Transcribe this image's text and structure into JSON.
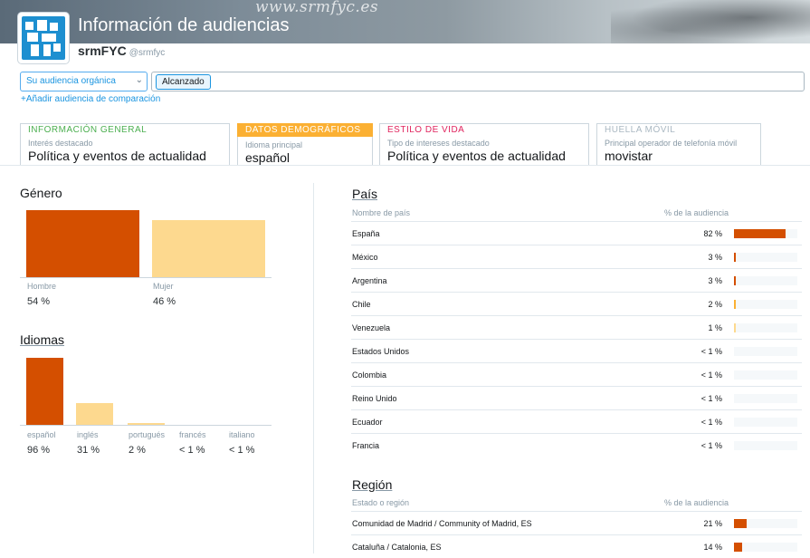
{
  "header": {
    "watermark": "www.srmfyc.es",
    "title": "Información de audiencias",
    "name": "srmFYC",
    "handle": "@srmfyc"
  },
  "controls": {
    "audience_select": "Su audiencia orgánica",
    "chip": "Alcanzado",
    "add_comparison": "+Añadir audiencia de comparación"
  },
  "cards": [
    {
      "category": "INFORMACIÓN GENERAL",
      "subtitle": "Interés destacado",
      "value": "Política y eventos de actualidad",
      "color": "#4caf50"
    },
    {
      "category": "DATOS DEMOGRÁFICOS",
      "subtitle": "Idioma principal",
      "value": "español",
      "color": "#fbb033"
    },
    {
      "category": "ESTILO DE VIDA",
      "subtitle": "Tipo de intereses destacado",
      "value": "Política y eventos de actualidad",
      "color": "#e0245e"
    },
    {
      "category": "HUELLA MÓVIL",
      "subtitle": "Principal operador de telefonía móvil",
      "value": "movistar",
      "color": "#aab8c2"
    }
  ],
  "gender": {
    "title": "Género",
    "items": [
      {
        "label": "Hombre",
        "pct": "54 %",
        "value": 54,
        "color": "#d44f00"
      },
      {
        "label": "Mujer",
        "pct": "46 %",
        "value": 46,
        "color": "#fdd98f"
      }
    ]
  },
  "languages": {
    "title": "Idiomas",
    "items": [
      {
        "label": "español",
        "pct": "96 %",
        "value": 96,
        "color": "#d44f00"
      },
      {
        "label": "inglés",
        "pct": "31 %",
        "value": 31,
        "color": "#fdd98f"
      },
      {
        "label": "portugués",
        "pct": "2 %",
        "value": 2,
        "color": "#fdd98f"
      },
      {
        "label": "francés",
        "pct": "< 1 %",
        "value": 0,
        "color": "#fdd98f"
      },
      {
        "label": "italiano",
        "pct": "< 1 %",
        "value": 0,
        "color": "#fdd98f"
      }
    ]
  },
  "country": {
    "title": "País",
    "col_name": "Nombre de país",
    "col_pct": "% de la audiencia",
    "rows": [
      {
        "name": "España",
        "pct": "82 %",
        "value": 82,
        "color": "#d44f00"
      },
      {
        "name": "México",
        "pct": "3 %",
        "value": 3,
        "color": "#d44f00"
      },
      {
        "name": "Argentina",
        "pct": "3 %",
        "value": 3,
        "color": "#d44f00"
      },
      {
        "name": "Chile",
        "pct": "2 %",
        "value": 2,
        "color": "#fbb033"
      },
      {
        "name": "Venezuela",
        "pct": "1 %",
        "value": 1,
        "color": "#fdd98f"
      },
      {
        "name": "Estados Unidos",
        "pct": "< 1 %",
        "value": 0,
        "color": "#fdd98f"
      },
      {
        "name": "Colombia",
        "pct": "< 1 %",
        "value": 0,
        "color": "#fdd98f"
      },
      {
        "name": "Reino Unido",
        "pct": "< 1 %",
        "value": 0,
        "color": "#fdd98f"
      },
      {
        "name": "Ecuador",
        "pct": "< 1 %",
        "value": 0,
        "color": "#fdd98f"
      },
      {
        "name": "Francia",
        "pct": "< 1 %",
        "value": 0,
        "color": "#fdd98f"
      }
    ]
  },
  "region": {
    "title": "Región",
    "col_name": "Estado o región",
    "col_pct": "% de la audiencia",
    "rows": [
      {
        "name": "Comunidad de Madrid / Community of Madrid, ES",
        "pct": "21 %",
        "value": 21,
        "color": "#d44f00"
      },
      {
        "name": "Cataluña / Catalonia, ES",
        "pct": "14 %",
        "value": 14,
        "color": "#d44f00"
      }
    ]
  }
}
